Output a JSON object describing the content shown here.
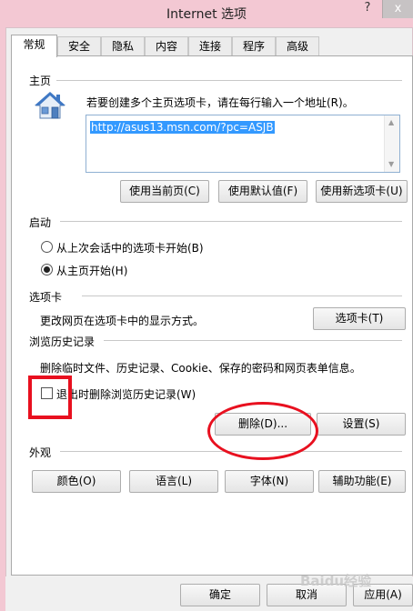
{
  "window": {
    "title": "Internet 选项",
    "help_glyph": "?",
    "close_glyph": "x"
  },
  "tabs": [
    {
      "label": "常规",
      "active": true
    },
    {
      "label": "安全"
    },
    {
      "label": "隐私"
    },
    {
      "label": "内容"
    },
    {
      "label": "连接"
    },
    {
      "label": "程序"
    },
    {
      "label": "高级"
    }
  ],
  "homepage": {
    "section_title": "主页",
    "description": "若要创建多个主页选项卡，请在每行输入一个地址(R)。",
    "url": "http://asus13.msn.com/?pc=ASJB",
    "icon": "house-icon",
    "use_current_label": "使用当前页(C)",
    "use_default_label": "使用默认值(F)",
    "use_new_tab_label": "使用新选项卡(U)"
  },
  "startup": {
    "section_title": "启动",
    "option_last_session": "从上次会话中的选项卡开始(B)",
    "option_homepage": "从主页开始(H)",
    "selected": "option_homepage"
  },
  "tabs_section": {
    "section_title": "选项卡",
    "description": "更改网页在选项卡中的显示方式。",
    "button_label": "选项卡(T)"
  },
  "history": {
    "section_title": "浏览历史记录",
    "description": "删除临时文件、历史记录、Cookie、保存的密码和网页表单信息。",
    "delete_on_exit_label": "退出时删除浏览历史记录(W)",
    "delete_on_exit_checked": false,
    "delete_label": "删除(D)...",
    "settings_label": "设置(S)"
  },
  "appearance": {
    "section_title": "外观",
    "colors_label": "颜色(O)",
    "languages_label": "语言(L)",
    "fonts_label": "字体(N)",
    "accessibility_label": "辅助功能(E)"
  },
  "footer": {
    "ok_label": "确定",
    "cancel_label": "取消",
    "apply_label": "应用(A)"
  },
  "watermark": "Baidu经验",
  "colors": {
    "annotation_red": "#e8101f",
    "selection_blue": "#3399ff",
    "window_frame_pink": "#f3c8d3"
  }
}
